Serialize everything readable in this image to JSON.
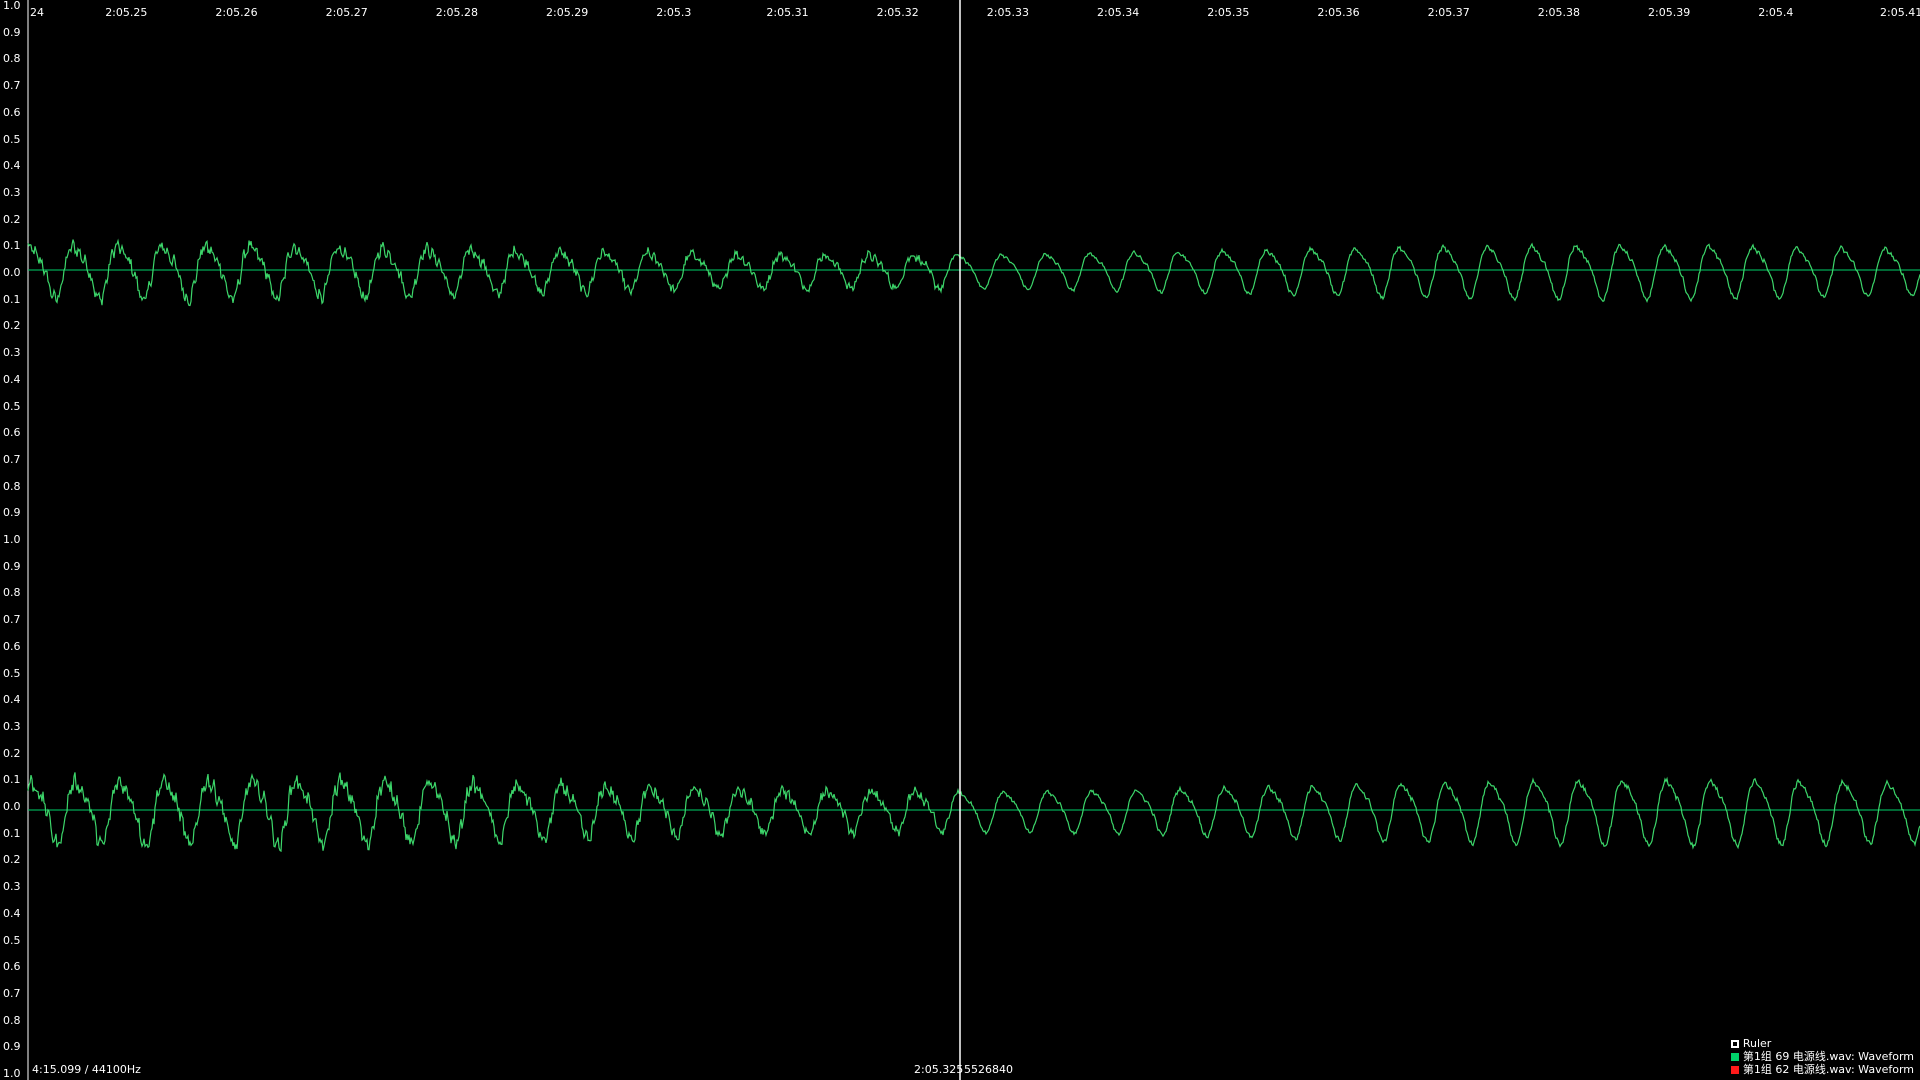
{
  "window": {
    "title": ""
  },
  "colors": {
    "background": "#000000",
    "wave_track_1": "#3cd66a",
    "wave_track_2": "#3cd66a",
    "zero_line": "#00d26a",
    "ruler": "#ffffff",
    "legend_red": "#ff1a1a"
  },
  "time_ticks": [
    "24",
    "2:05.25",
    "2:05.26",
    "2:05.27",
    "2:05.28",
    "2:05.29",
    "2:05.3",
    "2:05.31",
    "2:05.32",
    "2:05.33",
    "2:05.34",
    "2:05.35",
    "2:05.36",
    "2:05.37",
    "2:05.38",
    "2:05.39",
    "2:05.4",
    "2:05.41"
  ],
  "amplitude_ticks": [
    "1.0",
    "0.9",
    "0.8",
    "0.7",
    "0.6",
    "0.5",
    "0.4",
    "0.3",
    "0.2",
    "0.1",
    "0.0",
    "0.1",
    "0.2",
    "0.3",
    "0.4",
    "0.5",
    "0.6",
    "0.7",
    "0.8",
    "0.9",
    "1.0",
    "0.9",
    "0.8",
    "0.7",
    "0.6",
    "0.5",
    "0.4",
    "0.3",
    "0.2",
    "0.1",
    "0.0",
    "0.1",
    "0.2",
    "0.3",
    "0.4",
    "0.5",
    "0.6",
    "0.7",
    "0.8",
    "0.9",
    "1.0"
  ],
  "status": {
    "duration_rate": "4:15.099 / 44100Hz",
    "cursor_time": "2:05.325",
    "cursor_sample": "5526840"
  },
  "legend": {
    "ruler": "Ruler",
    "track1": "第1组 69 电源线.wav: Waveform",
    "track2": "第1组 62 电源线.wav: Waveform"
  },
  "icons": {
    "ruler_swatch": "square-outline-icon",
    "track_swatch": "square-filled-icon"
  }
}
